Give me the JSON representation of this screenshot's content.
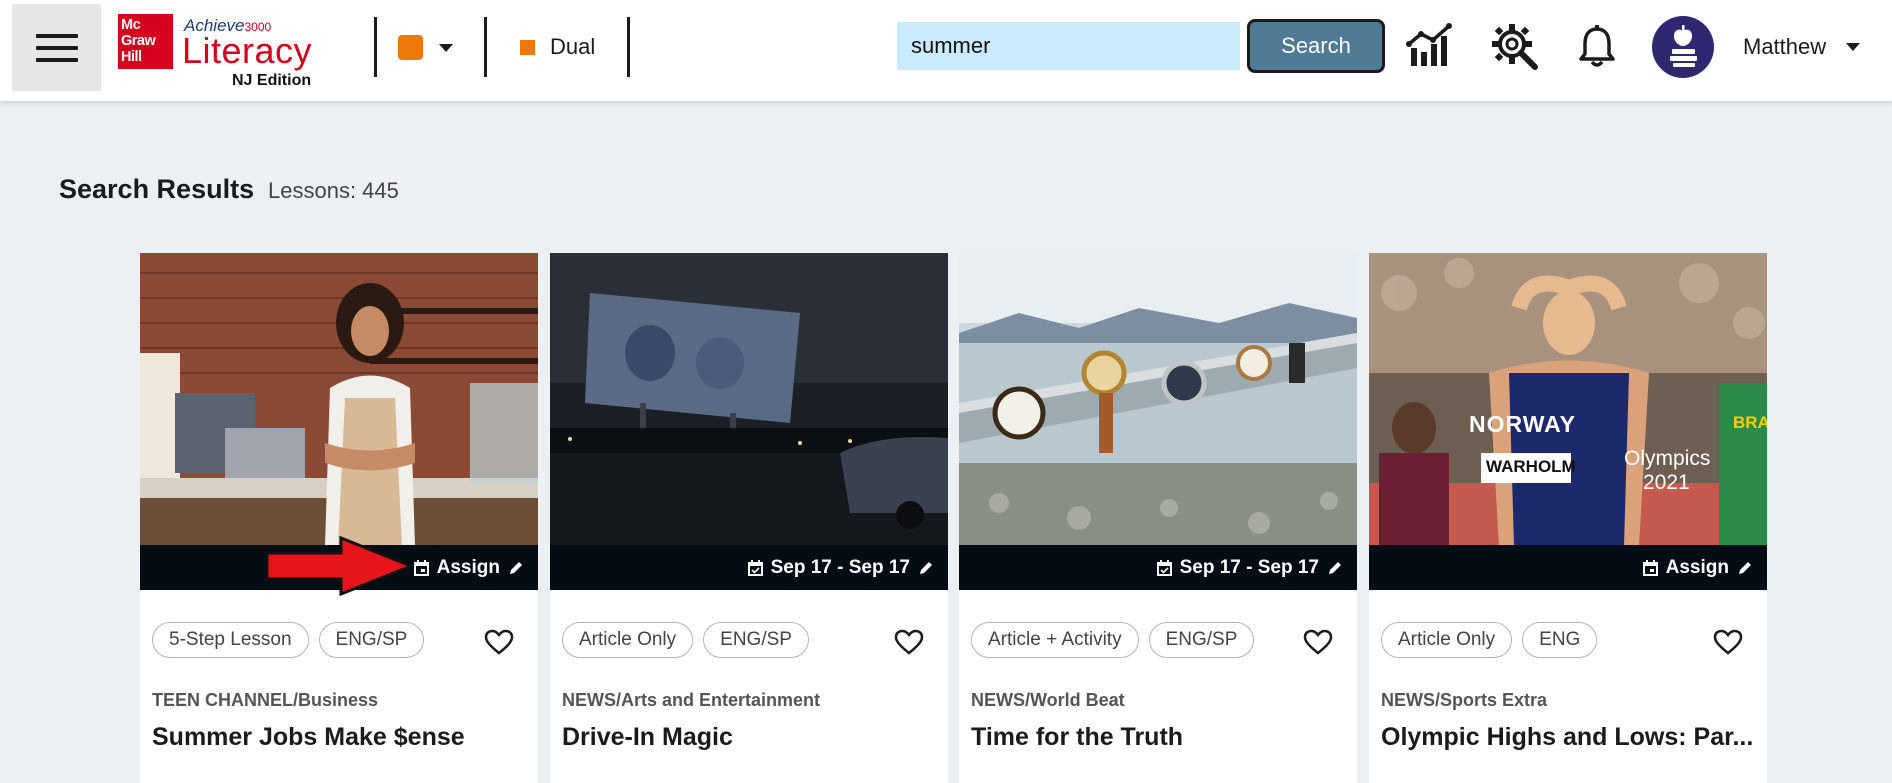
{
  "header": {
    "menu_icon": "hamburger-menu-icon",
    "logo": {
      "publisher_line1": "Mc",
      "publisher_line2": "Graw",
      "publisher_line3": "Hill",
      "product_prefix": "Achieve",
      "product_number": "3000",
      "product_name": "Literacy",
      "edition": "NJ Edition"
    },
    "color_selector": {
      "color": "#ee7a0d"
    },
    "language_mode": {
      "label": "Dual",
      "color": "#ee7a0d"
    },
    "search": {
      "value": "summer",
      "button_label": "Search"
    },
    "icons": [
      "reports-chart-icon",
      "search-settings-gear-icon",
      "notification-bell-icon"
    ],
    "user": {
      "name": "Matthew",
      "avatar_icon": "apple-books-avatar-icon"
    }
  },
  "results": {
    "title": "Search Results",
    "count": "Lessons: 445"
  },
  "cards": [
    {
      "bar_label": "Assign",
      "bar_icon": "calendar-icon",
      "tags": [
        "5-Step Lesson",
        "ENG/SP"
      ],
      "category": "TEEN CHANNEL/Business",
      "title": "Summer Jobs Make $ense"
    },
    {
      "bar_label": "Sep 17 - Sep 17",
      "bar_icon": "calendar-check-icon",
      "tags": [
        "Article Only",
        "ENG/SP"
      ],
      "category": "NEWS/Arts and Entertainment",
      "title": "Drive-In Magic"
    },
    {
      "bar_label": "Sep 17 - Sep 17",
      "bar_icon": "calendar-check-icon",
      "tags": [
        "Article + Activity",
        "ENG/SP"
      ],
      "category": "NEWS/World Beat",
      "title": "Time for the Truth"
    },
    {
      "bar_label": "Assign",
      "bar_icon": "calendar-icon",
      "tags": [
        "Article Only",
        "ENG"
      ],
      "category": "NEWS/Sports Extra",
      "title": "Olympic Highs and Lows: Par...",
      "image_text": {
        "jersey_country": "NORWAY",
        "bib_name": "WARHOLM",
        "overlay_line1": "Olympics",
        "overlay_line2": "2021",
        "partial_text": "BRA"
      }
    }
  ],
  "colors": {
    "accent_orange": "#ee7a0d",
    "search_field_bg": "#c9ebfb",
    "search_button_bg": "#4f7b95",
    "brand_red": "#d6001c",
    "avatar_bg": "#2f2770",
    "date_bar_bg": "#050d14"
  }
}
